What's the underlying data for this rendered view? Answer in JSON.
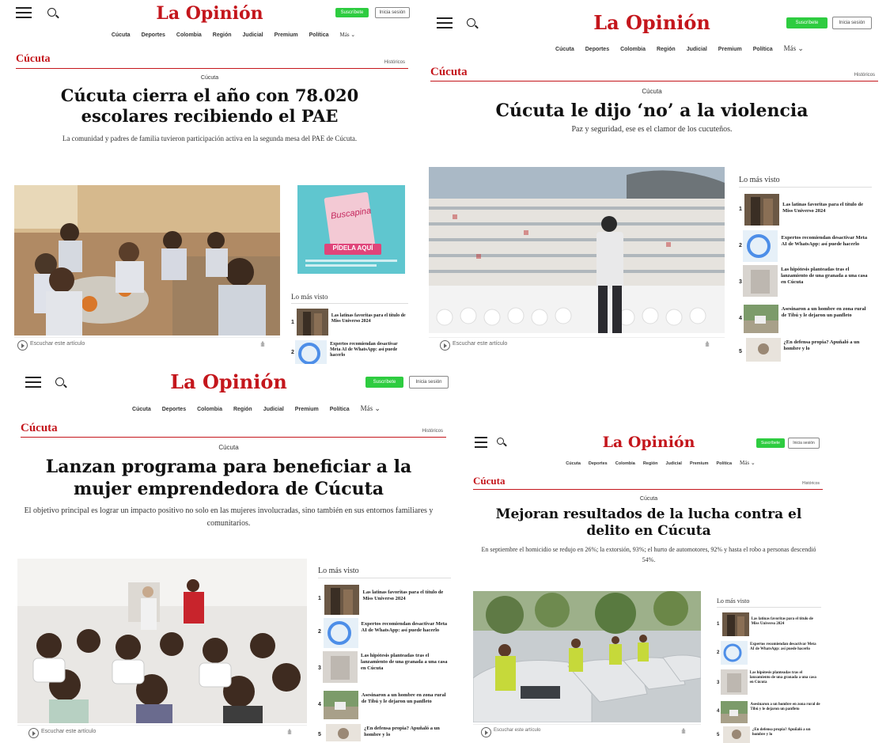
{
  "site": {
    "logo": "La Opinión",
    "subscribe_label": "Suscríbete",
    "login_label": "Inicia sesión",
    "nav": [
      "Cúcuta",
      "Deportes",
      "Colombia",
      "Región",
      "Judicial",
      "Premium",
      "Política"
    ],
    "nav_more": "Más ⌄",
    "section": "Cúcuta",
    "historicos": "Históricos",
    "listen_label": "Escuchar este artículo",
    "most_read_title": "Lo más visto"
  },
  "most_read": [
    "Las latinas favoritas para el título de Miss Universo 2024",
    "Expertos recomiendan desactivar Meta AI de WhatsApp: así puede hacerlo",
    "Las hipótesis planteadas tras el lanzamiento de una granada a una casa en Cúcuta",
    "Asesinaron a un hombre en zona rural de Tibú y le dejaron un panfleto",
    "¿En defensa propia? Apuñaló a un hombre y lo"
  ],
  "articles": [
    {
      "kicker": "Cúcuta",
      "headline": "Cúcuta cierra el año con 78.020 escolares recibiendo el PAE",
      "subtitle": "La comunidad y padres de familia tuvieron participación activa en la segunda mesa del PAE de Cúcuta.",
      "photo": "children-lunch-photo",
      "ad": {
        "brand": "Buscapina",
        "cta": "PÍDELA AQUÍ"
      }
    },
    {
      "kicker": "Cúcuta",
      "headline": "Cúcuta le dijo ‘no’ a la violencia",
      "subtitle": "Paz y seguridad, ese es el clamor de los cucuteños.",
      "photo": "stadium-crowd-photo"
    },
    {
      "kicker": "Cúcuta",
      "headline": "Lanzan programa para beneficiar a la mujer emprendedora de Cúcuta",
      "subtitle": "El objetivo principal es lograr un impacto positivo no solo en las mujeres involucradas, sino también en sus entornos familiares y comunitarios.",
      "photo": "women-meeting-photo"
    },
    {
      "kicker": "Cúcuta",
      "headline": "Mejoran resultados de la lucha contra el delito en Cúcuta",
      "subtitle": "En septiembre el homicidio se redujo en 26%; la extorsión, 93%; el hurto de automotores, 92% y hasta el robo a personas descendió 54%.",
      "photo": "police-vehicles-photo"
    }
  ],
  "colors": {
    "brand": "#c4161c",
    "subscribe": "#2ecc40"
  }
}
